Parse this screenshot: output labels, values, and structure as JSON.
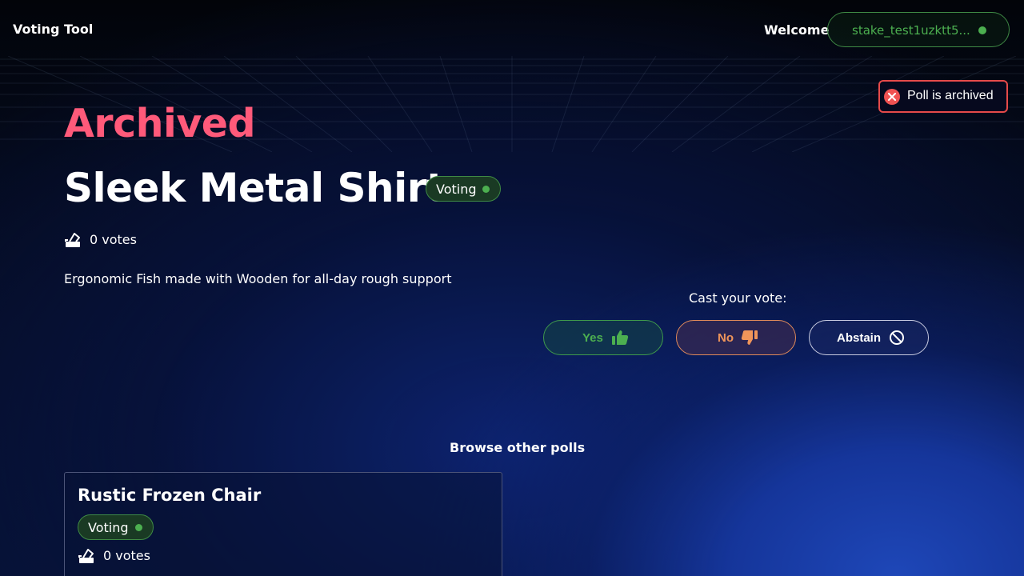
{
  "header": {
    "app_title": "Voting Tool",
    "welcome_label": "Welcome",
    "wallet_address": "stake_test1uzktt5...",
    "wallet_status_color": "#4caf50"
  },
  "toast": {
    "message": "Poll is archived",
    "icon": "close-circle-icon",
    "color": "#e64a4a"
  },
  "poll": {
    "status_heading": "Archived",
    "title": "Sleek Metal Shirt",
    "badge": "Voting",
    "votes": "0 votes",
    "description": "Ergonomic Fish made with Wooden for all-day rough support"
  },
  "vote": {
    "prompt": "Cast your vote:",
    "options": [
      {
        "label": "Yes",
        "icon": "thumbs-up-icon",
        "color": "#4caf50"
      },
      {
        "label": "No",
        "icon": "thumbs-down-icon",
        "color": "#f0955a"
      },
      {
        "label": "Abstain",
        "icon": "ban-icon",
        "color": "#ffffff"
      }
    ]
  },
  "browse": {
    "heading": "Browse other polls",
    "polls": [
      {
        "title": "Rustic Frozen Chair",
        "badge": "Voting",
        "votes": "0 votes"
      }
    ]
  },
  "colors": {
    "accent_archived": "#ff5a7a",
    "status_green": "#4caf50"
  }
}
